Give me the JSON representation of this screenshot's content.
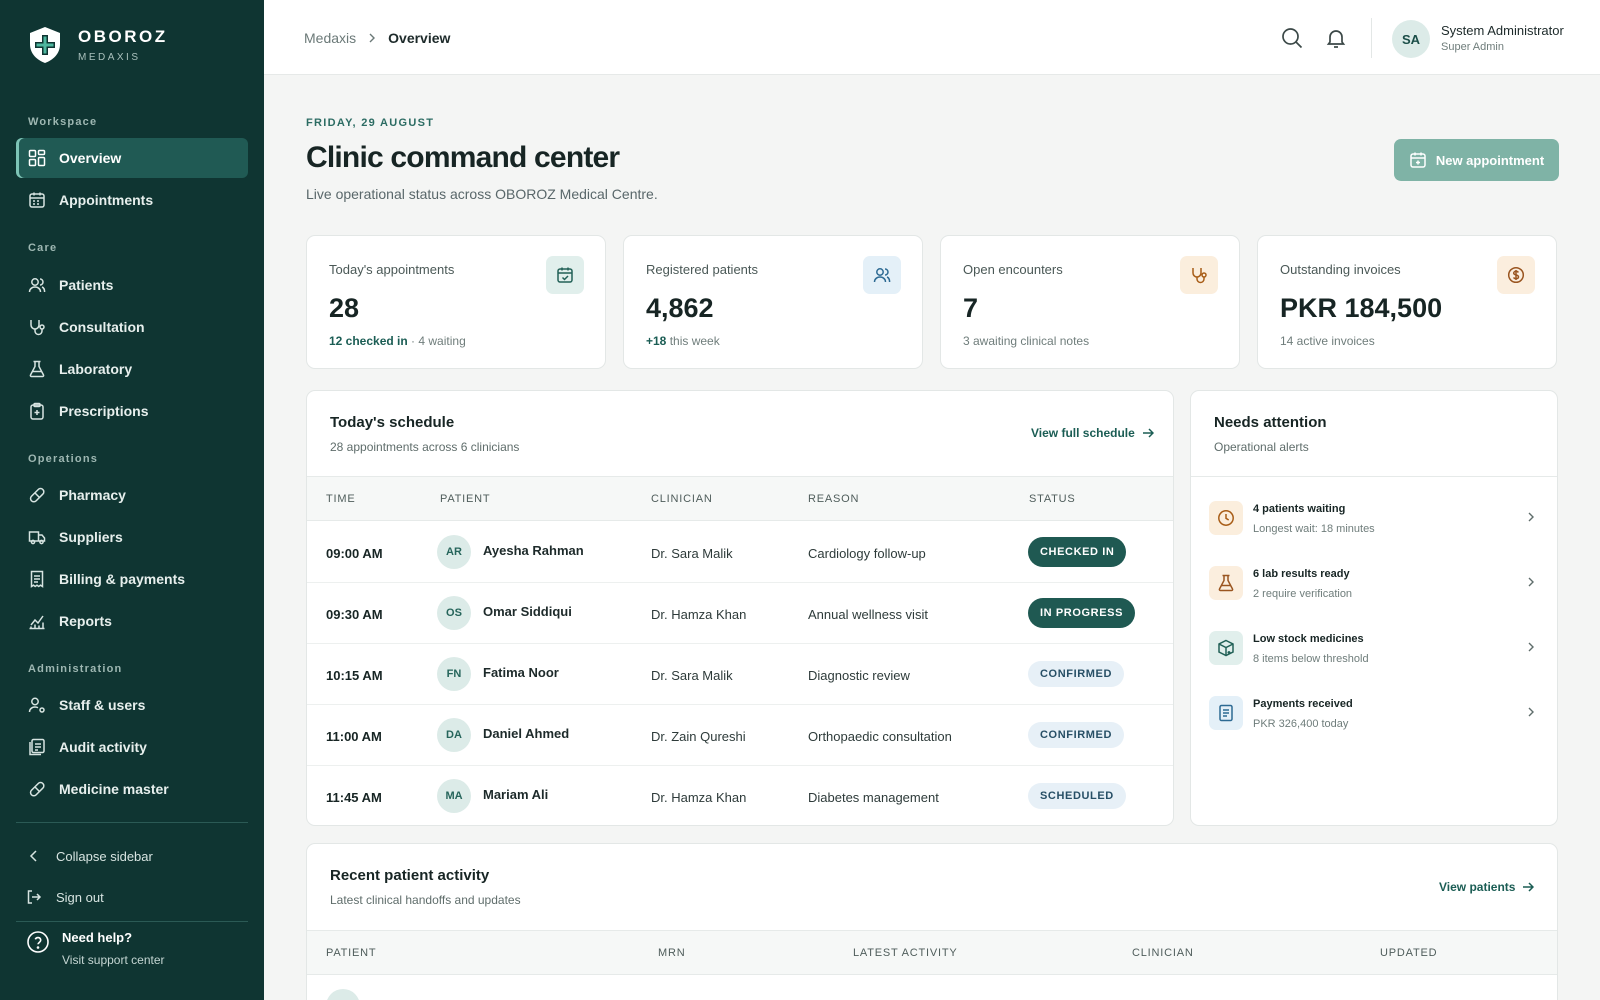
{
  "brand": {
    "name": "OBOROZ",
    "sub": "MEDAXIS"
  },
  "sidebar": {
    "groups": {
      "workspace": "Workspace",
      "care": "Care",
      "operations": "Operations",
      "administration": "Administration"
    },
    "items": {
      "overview": "Overview",
      "appointments": "Appointments",
      "patients": "Patients",
      "consultation": "Consultation",
      "laboratory": "Laboratory",
      "prescriptions": "Prescriptions",
      "pharmacy": "Pharmacy",
      "suppliers": "Suppliers",
      "billing": "Billing & payments",
      "reports": "Reports",
      "staff": "Staff & users",
      "audit": "Audit activity",
      "medicine_master": "Medicine master"
    },
    "collapse": "Collapse sidebar",
    "sign_out": "Sign out",
    "help_title": "Need help?",
    "help_sub": "Visit support center"
  },
  "topbar": {
    "breadcrumb_root": "Medaxis",
    "breadcrumb_current": "Overview",
    "user_initials": "SA",
    "user_name": "System Administrator",
    "user_role": "Super Admin"
  },
  "header": {
    "date": "FRIDAY, 29 AUGUST",
    "title": "Clinic command center",
    "subtitle": "Live operational status across OBOROZ Medical Centre.",
    "new_button": "New appointment"
  },
  "stats": {
    "appointments": {
      "label": "Today's appointments",
      "value": "28",
      "note_strong": "12 checked in",
      "note": " · 4 waiting"
    },
    "patients": {
      "label": "Registered patients",
      "value": "4,862",
      "note_strong": "+18",
      "note": " this week"
    },
    "encounters": {
      "label": "Open encounters",
      "value": "7",
      "note": "3 awaiting clinical notes"
    },
    "invoices": {
      "label": "Outstanding invoices",
      "value": "PKR 184,500",
      "note": "14 active invoices"
    }
  },
  "schedule": {
    "title": "Today's schedule",
    "subtitle": "28 appointments across 6 clinicians",
    "link": "View full schedule",
    "columns": {
      "time": "TIME",
      "patient": "PATIENT",
      "clinician": "CLINICIAN",
      "reason": "REASON",
      "status": "STATUS"
    },
    "rows": [
      {
        "time": "09:00 AM",
        "initials": "AR",
        "patient": "Ayesha Rahman",
        "clinician": "Dr. Sara Malik",
        "reason": "Cardiology follow-up",
        "status": "CHECKED IN"
      },
      {
        "time": "09:30 AM",
        "initials": "OS",
        "patient": "Omar Siddiqui",
        "clinician": "Dr. Hamza Khan",
        "reason": "Annual wellness visit",
        "status": "IN PROGRESS"
      },
      {
        "time": "10:15 AM",
        "initials": "FN",
        "patient": "Fatima Noor",
        "clinician": "Dr. Sara Malik",
        "reason": "Diagnostic review",
        "status": "CONFIRMED"
      },
      {
        "time": "11:00 AM",
        "initials": "DA",
        "patient": "Daniel Ahmed",
        "clinician": "Dr. Zain Qureshi",
        "reason": "Orthopaedic consultation",
        "status": "CONFIRMED"
      },
      {
        "time": "11:45 AM",
        "initials": "MA",
        "patient": "Mariam Ali",
        "clinician": "Dr. Hamza Khan",
        "reason": "Diabetes management",
        "status": "SCHEDULED"
      }
    ]
  },
  "attention": {
    "title": "Needs attention",
    "subtitle": "Operational alerts",
    "items": [
      {
        "title": "4 patients waiting",
        "sub": "Longest wait: 18 minutes"
      },
      {
        "title": "6 lab results ready",
        "sub": "2 require verification"
      },
      {
        "title": "Low stock medicines",
        "sub": "8 items below threshold"
      },
      {
        "title": "Payments received",
        "sub": "PKR 326,400 today"
      }
    ]
  },
  "activity": {
    "title": "Recent patient activity",
    "subtitle": "Latest clinical handoffs and updates",
    "link": "View patients",
    "columns": {
      "patient": "PATIENT",
      "mrn": "MRN",
      "latest": "LATEST ACTIVITY",
      "clinician": "CLINICIAN",
      "updated": "UPDATED"
    }
  },
  "colors": {
    "sidebar_bg": "#0f3532",
    "accent": "#1b5d54",
    "primary_button": "#7fb3a6",
    "status_dark": "#1f5952",
    "status_light": "#e7f0f7"
  }
}
